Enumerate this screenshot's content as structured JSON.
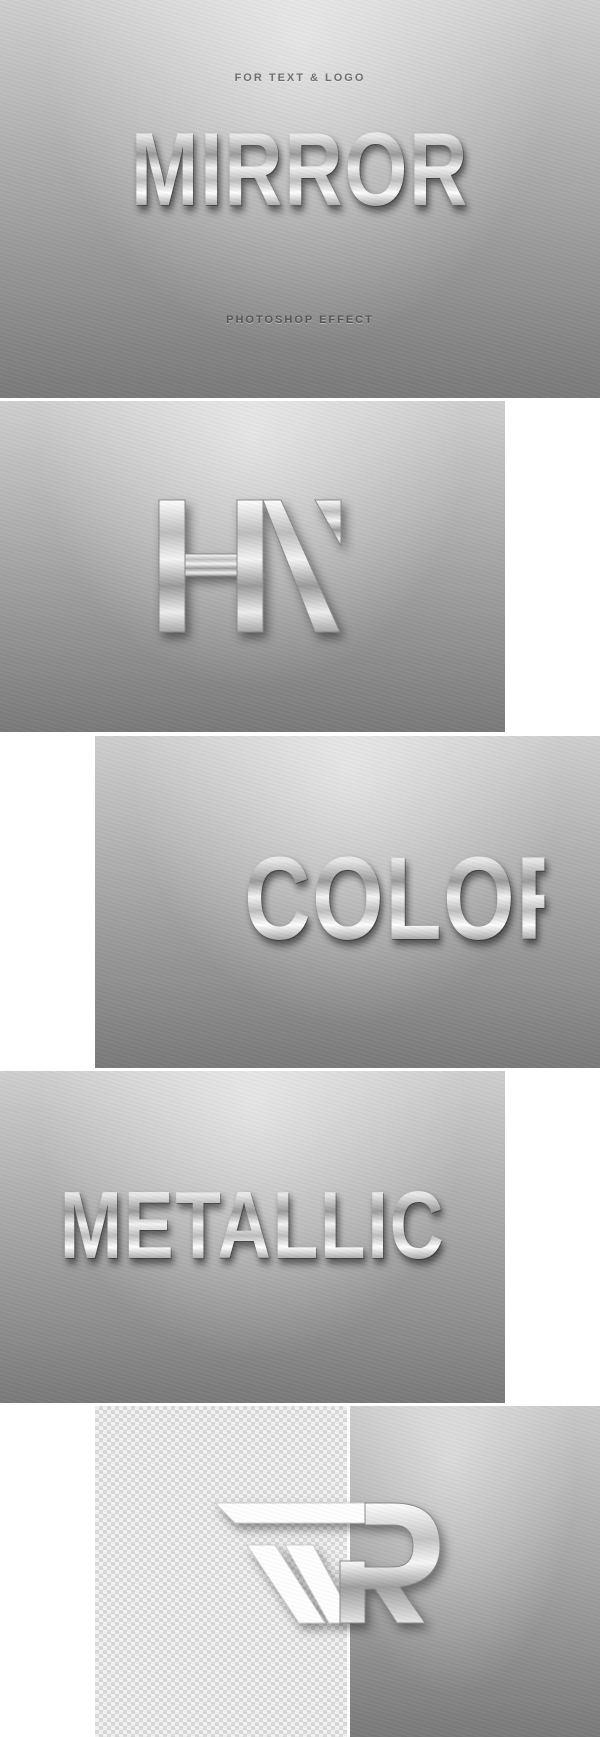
{
  "panels": [
    {
      "caption_top": "FOR TEXT & LOGO",
      "title": "MIRROR",
      "caption_bottom": "PHOTOSHOP EFFECT"
    },
    {
      "logo": "hn-logo"
    },
    {
      "title": "COLOR"
    },
    {
      "title": "METALLIC"
    },
    {
      "logo": "r-logo",
      "left_background": "transparency-checkerboard"
    }
  ],
  "colors": {
    "wall_light": "#cfcfcf",
    "wall_dark": "#7a7a7a",
    "chrome_highlight": "#ffffff",
    "chrome_shadow": "#8e8e8e"
  }
}
